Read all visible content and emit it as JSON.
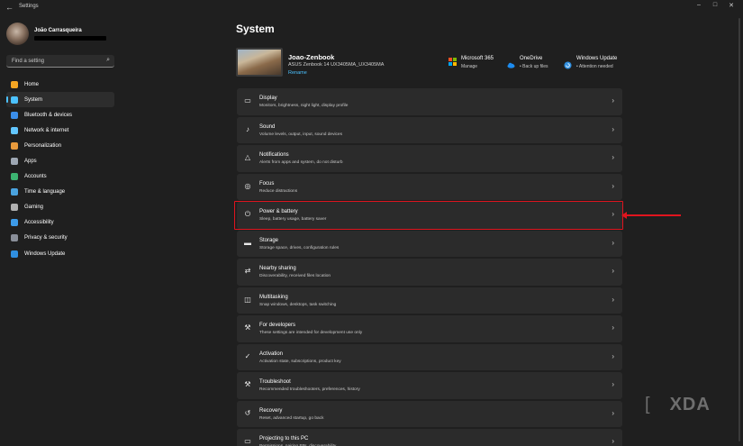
{
  "window": {
    "app_title": "Settings",
    "back_icon": "←",
    "minimize_icon": "–",
    "maximize_icon": "□",
    "close_icon": "✕"
  },
  "user": {
    "name": "João Carrasqueira"
  },
  "search": {
    "placeholder": "Find a setting",
    "icon": "⌕"
  },
  "sidebar": {
    "items": [
      {
        "label": "Home",
        "icon": "home-icon",
        "color": "#f5a623",
        "selected": false
      },
      {
        "label": "System",
        "icon": "system-icon",
        "color": "#4cc2ff",
        "selected": true
      },
      {
        "label": "Bluetooth & devices",
        "icon": "bluetooth-icon",
        "color": "#3b8eea",
        "selected": false
      },
      {
        "label": "Network & internet",
        "icon": "wifi-icon",
        "color": "#62c6ff",
        "selected": false
      },
      {
        "label": "Personalization",
        "icon": "brush-icon",
        "color": "#e89a3c",
        "selected": false
      },
      {
        "label": "Apps",
        "icon": "apps-icon",
        "color": "#9ea7b3",
        "selected": false
      },
      {
        "label": "Accounts",
        "icon": "accounts-icon",
        "color": "#3cb371",
        "selected": false
      },
      {
        "label": "Time & language",
        "icon": "globe-icon",
        "color": "#4aa3df",
        "selected": false
      },
      {
        "label": "Gaming",
        "icon": "gaming-icon",
        "color": "#b0b0b0",
        "selected": false
      },
      {
        "label": "Accessibility",
        "icon": "accessibility-icon",
        "color": "#3d9be9",
        "selected": false
      },
      {
        "label": "Privacy & security",
        "icon": "shield-icon",
        "color": "#8a8f99",
        "selected": false
      },
      {
        "label": "Windows Update",
        "icon": "update-icon",
        "color": "#2f8fe0",
        "selected": false
      }
    ]
  },
  "main": {
    "title": "System",
    "device": {
      "name": "Joao-Zenbook",
      "model": "ASUS Zenbook 14 UX3405MA_UX3405MA",
      "rename_label": "Rename"
    },
    "status": [
      {
        "title": "Microsoft 365",
        "subtitle": "Manage",
        "icon": "microsoft365-icon"
      },
      {
        "title": "OneDrive",
        "subtitle": "• Back up files",
        "icon": "onedrive-icon"
      },
      {
        "title": "Windows Update",
        "subtitle": "• Attention needed",
        "icon": "windows-update-icon"
      }
    ],
    "settings": [
      {
        "title": "Display",
        "subtitle": "Monitors, brightness, night light, display profile",
        "glyph": "▭",
        "icon": "display-icon"
      },
      {
        "title": "Sound",
        "subtitle": "Volume levels, output, input, sound devices",
        "glyph": "♪",
        "icon": "sound-icon"
      },
      {
        "title": "Notifications",
        "subtitle": "Alerts from apps and system, do not disturb",
        "glyph": "△",
        "icon": "bell-icon"
      },
      {
        "title": "Focus",
        "subtitle": "Reduce distractions",
        "glyph": "◎",
        "icon": "focus-icon"
      },
      {
        "title": "Power & battery",
        "subtitle": "Sleep, battery usage, battery saver",
        "glyph": "⏻",
        "icon": "power-icon"
      },
      {
        "title": "Storage",
        "subtitle": "Storage space, drives, configuration rules",
        "glyph": "▬",
        "icon": "storage-icon"
      },
      {
        "title": "Nearby sharing",
        "subtitle": "Discoverability, received files location",
        "glyph": "⇄",
        "icon": "share-icon"
      },
      {
        "title": "Multitasking",
        "subtitle": "Snap windows, desktops, task switching",
        "glyph": "◫",
        "icon": "multitasking-icon"
      },
      {
        "title": "For developers",
        "subtitle": "These settings are intended for development use only",
        "glyph": "⚒",
        "icon": "developer-icon"
      },
      {
        "title": "Activation",
        "subtitle": "Activation state, subscriptions, product key",
        "glyph": "✓",
        "icon": "activation-icon"
      },
      {
        "title": "Troubleshoot",
        "subtitle": "Recommended troubleshooters, preferences, history",
        "glyph": "⚒",
        "icon": "wrench-icon"
      },
      {
        "title": "Recovery",
        "subtitle": "Reset, advanced startup, go back",
        "glyph": "↺",
        "icon": "recovery-icon"
      },
      {
        "title": "Projecting to this PC",
        "subtitle": "Permissions, pairing PIN, discoverability",
        "glyph": "▭",
        "icon": "projecting-icon"
      }
    ],
    "chevron": "›"
  },
  "watermark": {
    "mark": "[ ",
    "text": "XDA"
  },
  "colors": {
    "accent": "#4cc2ff",
    "highlight": "#e0141e"
  }
}
